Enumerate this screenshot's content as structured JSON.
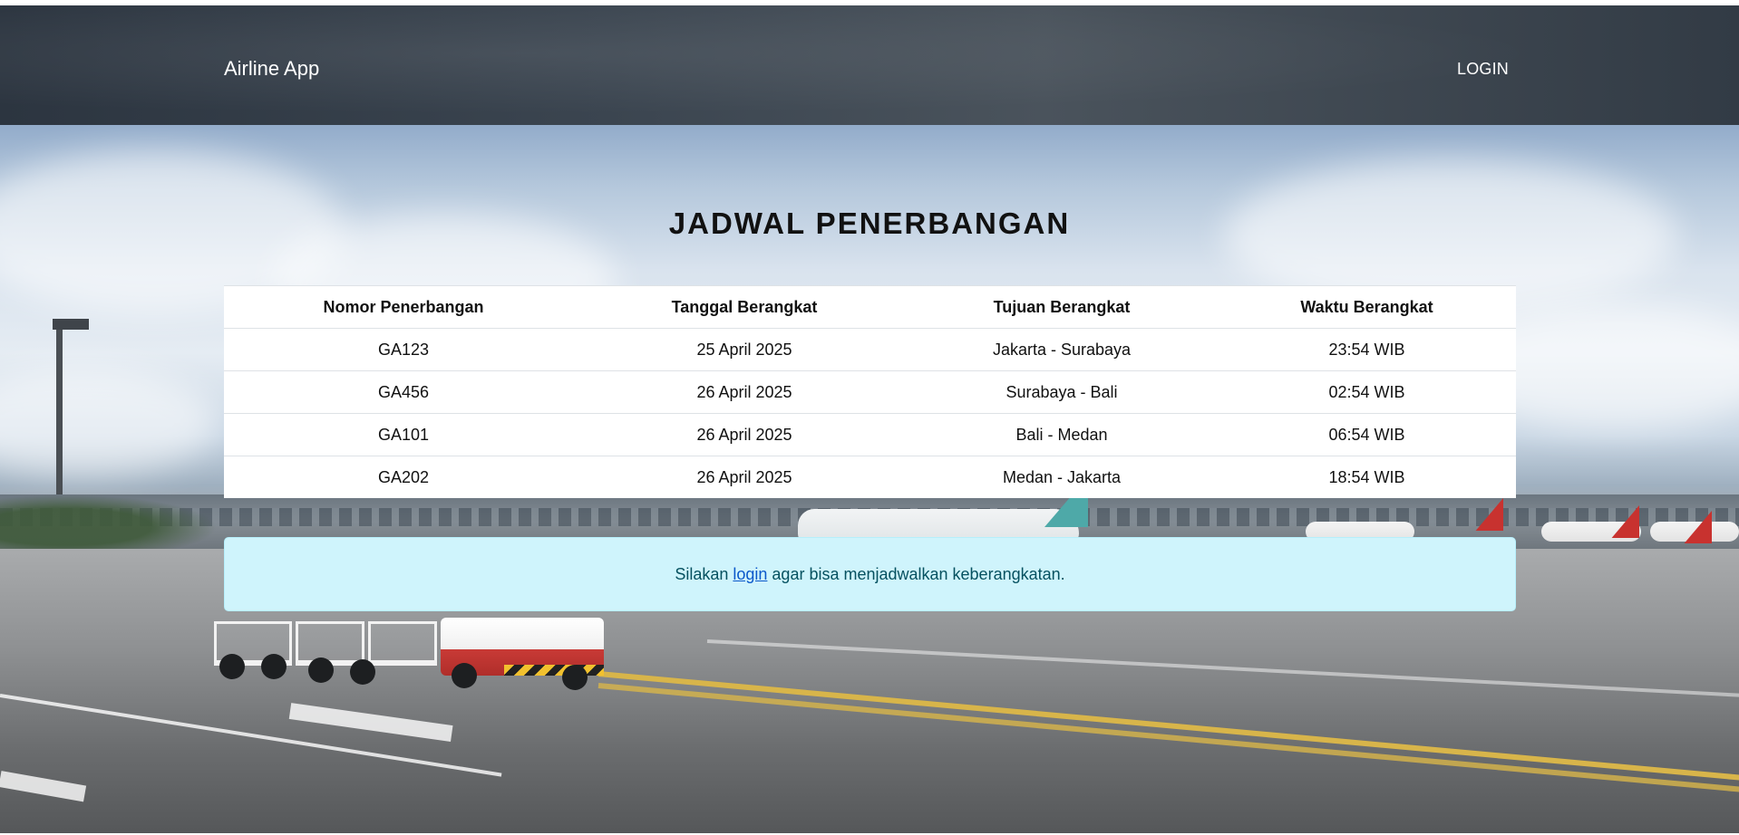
{
  "navbar": {
    "brand": "Airline App",
    "login_label": "LOGIN"
  },
  "main": {
    "title": "JADWAL PENERBANGAN",
    "table": {
      "headers": [
        "Nomor Penerbangan",
        "Tanggal Berangkat",
        "Tujuan Berangkat",
        "Waktu Berangkat"
      ],
      "rows": [
        [
          "GA123",
          "25 April 2025",
          "Jakarta - Surabaya",
          "23:54 WIB"
        ],
        [
          "GA456",
          "26 April 2025",
          "Surabaya - Bali",
          "02:54 WIB"
        ],
        [
          "GA101",
          "26 April 2025",
          "Bali - Medan",
          "06:54 WIB"
        ],
        [
          "GA202",
          "26 April 2025",
          "Medan - Jakarta",
          "18:54 WIB"
        ]
      ]
    },
    "alert": {
      "before": "Silakan",
      "link": "login",
      "after": "agar bisa menjadwalkan keberangkatan."
    }
  },
  "colors": {
    "alert_bg": "#cff4fc",
    "alert_text": "#055160",
    "link": "#0a58ca"
  }
}
